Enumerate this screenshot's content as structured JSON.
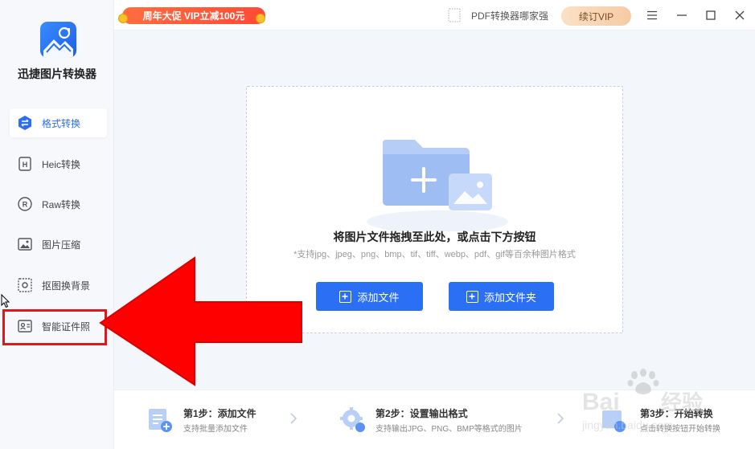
{
  "app": {
    "name": "迅捷图片转换器"
  },
  "sidebar": {
    "items": [
      {
        "label": "格式转换",
        "icon": "swap-icon",
        "active": true
      },
      {
        "label": "Heic转换",
        "icon": "heic-icon",
        "active": false
      },
      {
        "label": "Raw转换",
        "icon": "raw-icon",
        "active": false
      },
      {
        "label": "图片压缩",
        "icon": "image-compress-icon",
        "active": false
      },
      {
        "label": "抠图换背景",
        "icon": "cutout-icon",
        "active": false
      },
      {
        "label": "智能证件照",
        "icon": "id-photo-icon",
        "active": false
      }
    ]
  },
  "topbar": {
    "promo": "周年大促 VIP立减100元",
    "pdf_link": "PDF转换器哪家强",
    "renew_label": "续订VIP"
  },
  "dropzone": {
    "title": "将图片文件拖拽至此处，或点击下方按钮",
    "subtitle": "*支持jpg、jpeg、png、bmp、tif、tiff、webp、pdf、gif等百余种图片格式",
    "add_file_label": "添加文件",
    "add_folder_label": "添加文件夹"
  },
  "steps": [
    {
      "title": "第1步：添加文件",
      "desc": "支持批量添加文件"
    },
    {
      "title": "第2步：设置输出格式",
      "desc": "支持输出JPG、PNG、BMP等格式的图片"
    },
    {
      "title": "第3步：开始转换",
      "desc": "点击转换按钮开始转换"
    }
  ],
  "annotation": {
    "highlight_color": "#e0181e",
    "arrow_color": "#ff0000"
  },
  "colors": {
    "accent": "#2b6ff5",
    "promo": "#ff5a3a"
  }
}
